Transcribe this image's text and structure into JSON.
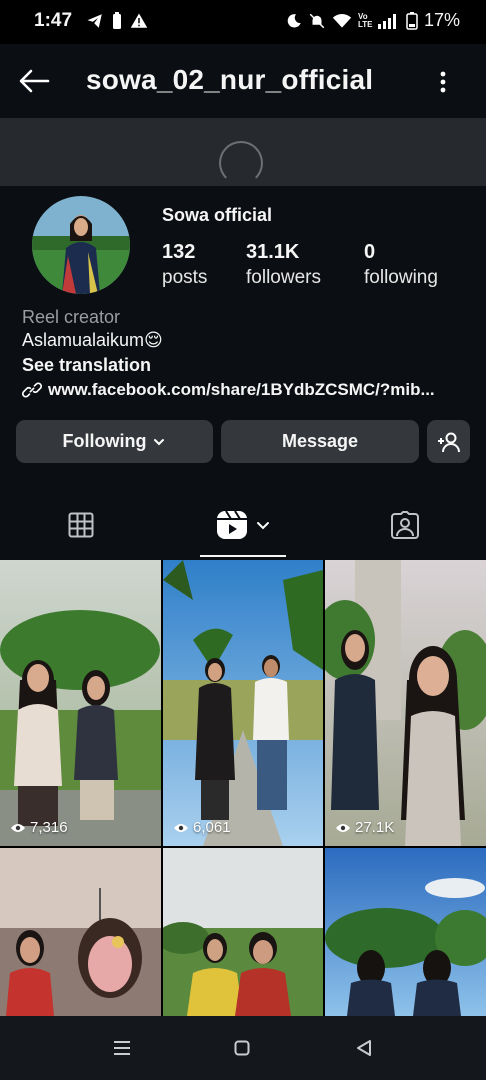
{
  "status_bar": {
    "time": "1:47",
    "battery": "17%",
    "volte": "Vo LTE"
  },
  "header": {
    "username": "sowa_02_nur_official"
  },
  "profile": {
    "display_name": "Sowa official",
    "stats": [
      {
        "value": "132",
        "label": "posts"
      },
      {
        "value": "31.1K",
        "label": "followers"
      },
      {
        "value": "0",
        "label": "following"
      }
    ],
    "category": "Reel creator",
    "bio": "Aslamualaikum😌",
    "see_translation": "See translation",
    "link": "www.facebook.com/share/1BYdbZCSMC/?mib..."
  },
  "actions": {
    "following_label": "Following",
    "message_label": "Message"
  },
  "tabs": [
    "grid",
    "reels",
    "tagged"
  ],
  "reels": [
    {
      "views": "7,316"
    },
    {
      "views": "6,061"
    },
    {
      "views": "27.1K"
    },
    {
      "views": ""
    },
    {
      "views": ""
    },
    {
      "views": ""
    }
  ]
}
